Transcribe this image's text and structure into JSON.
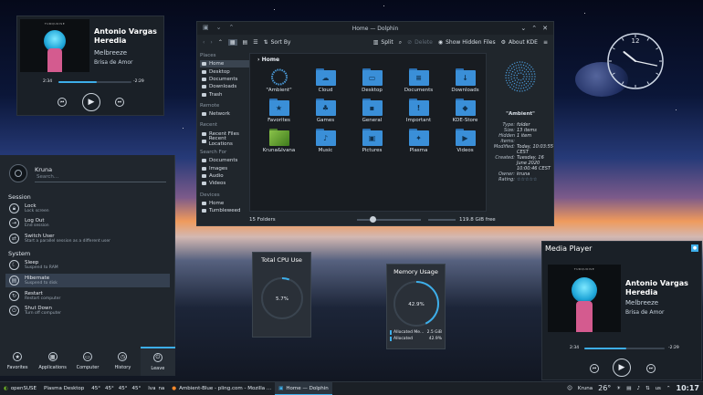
{
  "media_top": {
    "cover_tag": "TURQUOISE",
    "title": "Antonio Vargas Heredia",
    "album": "Melbreeze",
    "artist": "Brisa de Amor",
    "elapsed": "2:34",
    "remaining": "-2:29",
    "progress": 0.52
  },
  "dolphin": {
    "title": "Home — Dolphin",
    "toolbar": {
      "sort": "Sort By",
      "split": "Split",
      "delete": "Delete",
      "hidden": "Show Hidden Files",
      "about": "About KDE"
    },
    "sidebar": {
      "places_label": "Places",
      "places": [
        "Home",
        "Desktop",
        "Documents",
        "Downloads",
        "Trash"
      ],
      "remote_label": "Remote",
      "remote": [
        "Network"
      ],
      "recent_label": "Recent",
      "recent": [
        "Recent Files",
        "Recent Locations"
      ],
      "search_label": "Search For",
      "search": [
        "Documents",
        "Images",
        "Audio",
        "Videos"
      ],
      "devices_label": "Devices",
      "devices": [
        "Home",
        "Tumbleweed"
      ]
    },
    "breadcrumb": "Home",
    "files": [
      "\"Ambient\"",
      "Cloud",
      "Desktop",
      "Documents",
      "Downloads",
      "Favorites",
      "Games",
      "General",
      "Important",
      "KDE-Store",
      "Kruna&Ivana",
      "Music",
      "Pictures",
      "Plasma",
      "Videos"
    ],
    "status_left": "15 Folders",
    "status_right": "119.8 GiB free",
    "info": {
      "name": "\"Ambient\"",
      "rows": [
        {
          "k": "Type:",
          "v": "folder"
        },
        {
          "k": "Size:",
          "v": "13 items"
        },
        {
          "k": "Hidden items:",
          "v": "1 item"
        },
        {
          "k": "Modified:",
          "v": "Today, 10:03:55 CEST"
        },
        {
          "k": "Created:",
          "v": "Tuesday, 16 June 2020 10:00:46 CEST"
        },
        {
          "k": "Owner:",
          "v": "kruna"
        },
        {
          "k": "Rating:",
          "v": "☆☆☆☆☆"
        }
      ]
    }
  },
  "clock": {
    "hour": 10,
    "minute": 17,
    "label": "12"
  },
  "launcher": {
    "user": "Kruna",
    "search_placeholder": "Search...",
    "session_label": "Session",
    "system_label": "System",
    "session": [
      {
        "t": "Lock",
        "s": "Lock screen"
      },
      {
        "t": "Log Out",
        "s": "End session"
      },
      {
        "t": "Switch User",
        "s": "Start a parallel session as a different user"
      }
    ],
    "system": [
      {
        "t": "Sleep",
        "s": "Suspend to RAM"
      },
      {
        "t": "Hibernate",
        "s": "Suspend to disk"
      },
      {
        "t": "Restart",
        "s": "Restart computer"
      },
      {
        "t": "Shut Down",
        "s": "Turn off computer"
      }
    ],
    "tabs": [
      "Favorites",
      "Applications",
      "Computer",
      "History",
      "Leave"
    ]
  },
  "cpu": {
    "title": "Total CPU Use",
    "value": "5.7%",
    "fraction": 0.057
  },
  "memory": {
    "title": "Memory Usage",
    "value": "42.9%",
    "fraction": 0.429,
    "rows": [
      {
        "k": "Allocated Me...",
        "v": "2.5 GiB"
      },
      {
        "k": "Allocated",
        "v": "42.9%"
      }
    ]
  },
  "media_player": {
    "header": "Media Player",
    "cover_tag": "TURQUOISE",
    "title": "Antonio Vargas Heredia",
    "album": "Melbreeze",
    "artist": "Brisa de Amor",
    "elapsed": "2:34",
    "remaining": "-2:29",
    "progress": 0.52
  },
  "taskbar": {
    "start": "openSUSE",
    "desktop": "Plasma Desktop",
    "temps": [
      "45°",
      "45°",
      "45°",
      "45°"
    ],
    "lang1": "lva",
    "lang2": "na",
    "tasks": [
      "Ambient-Blue - pling.com - Mozilla ...",
      "Home — Dolphin"
    ],
    "user": "Kruna",
    "weather": "26°",
    "kb": "us",
    "time": "10:17"
  },
  "colors": {
    "accent": "#3daee9",
    "folder": "#3a8fd8"
  }
}
